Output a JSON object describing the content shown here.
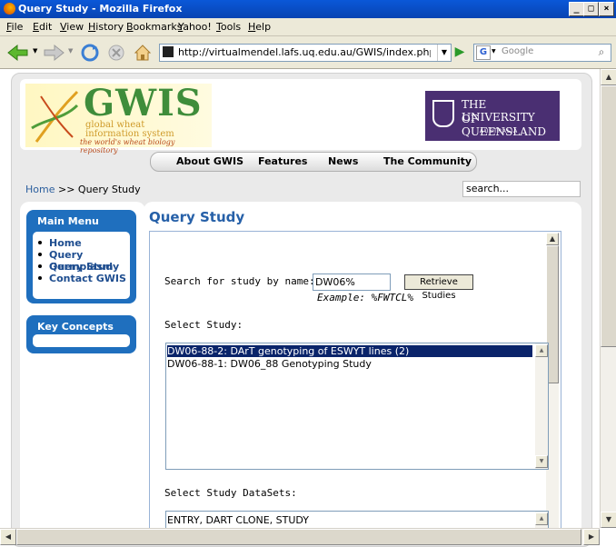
{
  "window": {
    "title": "Query Study - Mozilla Firefox"
  },
  "menubar": {
    "items": [
      "File",
      "Edit",
      "View",
      "History",
      "Bookmarks",
      "Yahoo!",
      "Tools",
      "Help"
    ]
  },
  "navbar": {
    "url": "http://virtualmendel.lafs.uq.edu.au/GWIS/index.php?option=com_w",
    "search_placeholder": "Google"
  },
  "header": {
    "gwis_logo": {
      "title": "GWIS",
      "line1": "global wheat",
      "line2": "information system",
      "tagline": "the world's wheat biology repository"
    },
    "uq_logo": {
      "line1": "THE UNIVERSITY",
      "line2": "OF QUEENSLAND",
      "line3": "AUSTRALIA"
    },
    "nav": [
      "About GWIS",
      "Features",
      "News",
      "The Community"
    ]
  },
  "breadcrumb": {
    "home": "Home",
    "sep": ">>",
    "current": "Query Study"
  },
  "site_search": {
    "value": "search..."
  },
  "main_menu": {
    "title": "Main Menu",
    "items": [
      "Home",
      "Query Germplasm",
      "Query Study",
      "Contact GWIS"
    ]
  },
  "key_concepts": {
    "title": "Key Concepts"
  },
  "main": {
    "title": "Query Study",
    "search_label": "Search for study by name:",
    "search_value": "DW06%",
    "retrieve_button": "Retrieve Studies",
    "example": "Example:  %FWTCL%",
    "select_study_label": "Select Study:",
    "studies": [
      "DW06-88-2: DArT genotyping of ESWYT lines (2)",
      "DW06-88-1: DW06_88 Genotyping Study"
    ],
    "datasets_label": "Select Study DataSets:",
    "datasets": [
      "ENTRY, DART CLONE, STUDY"
    ]
  },
  "colors": {
    "brand_blue": "#1f6fbe",
    "title_blue": "#2660a8",
    "uq_purple": "#4a2f72",
    "gwis_green": "#3f8d3b"
  }
}
